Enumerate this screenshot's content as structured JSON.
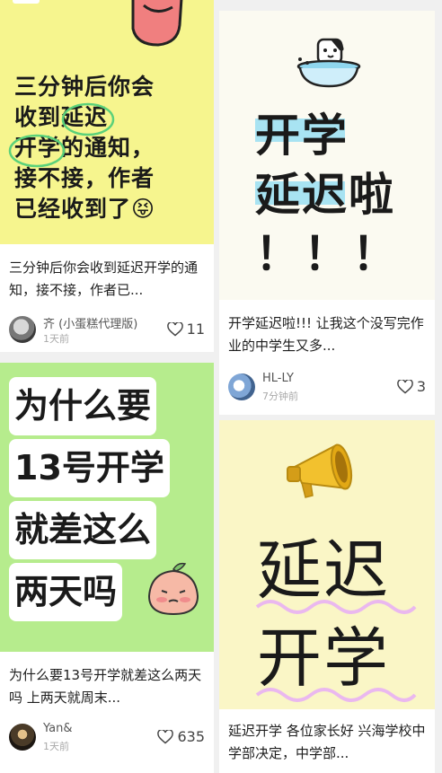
{
  "cards": [
    {
      "cover_lines": [
        "三分钟后你会",
        "收到延迟",
        "开学的通知，",
        "接不接，作者",
        "已经收到了😝"
      ],
      "caption": "三分钟后你会收到延迟开学的通知，接不接，作者已...",
      "author": "齐 (小蛋糕代理版)",
      "time": "1天前",
      "likes": "11"
    },
    {
      "cover_lines": [
        "开学",
        "延迟啦",
        "！！！"
      ],
      "caption": "开学延迟啦!!! 让我这个没写完作业的中学生又多...",
      "author": "HL-LY",
      "time": "7分钟前",
      "likes": "3"
    },
    {
      "cover_lines": [
        "为什么要",
        "13号开学",
        "就差这么",
        "两天吗"
      ],
      "caption": "为什么要13号开学就差这么两天吗 上两天就周末...",
      "author": "Yan&",
      "time": "1天前",
      "likes": "635"
    },
    {
      "cover_lines": [
        "延迟",
        "开学"
      ],
      "caption": "延迟开学 各位家长好 兴海学校中学部决定，中学部..."
    }
  ],
  "colors": {
    "yellow_cover": "#f6f58e",
    "cream_cover": "#fbfaf1",
    "green_cover": "#b6ec8d",
    "pale_yellow_cover": "#faf6c6",
    "highlight_blue": "#a8e3f2",
    "wave_pink": "#eab8ef"
  }
}
